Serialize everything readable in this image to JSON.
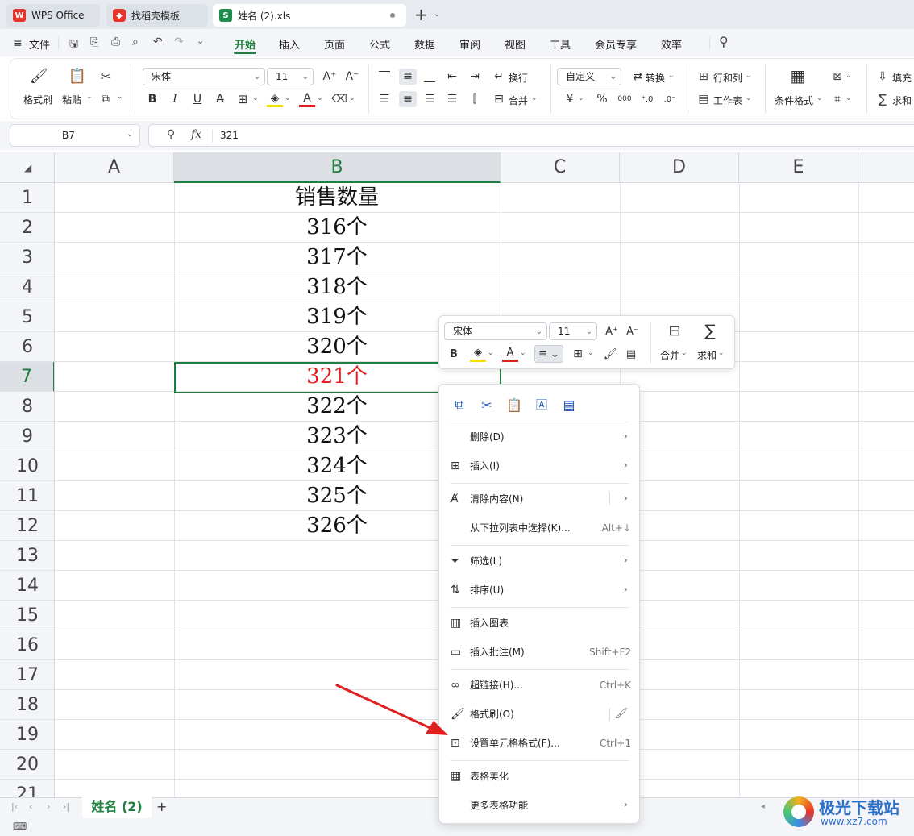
{
  "tabs": [
    {
      "label": "WPS Office",
      "icon": "wps-logo-icon",
      "color": "#e8332a"
    },
    {
      "label": "找稻壳模板",
      "icon": "docer-icon",
      "color": "#e8332a"
    },
    {
      "label": "姓名 (2).xls",
      "icon": "spreadsheet-s-icon",
      "color": "#1e8e4e"
    }
  ],
  "menu": {
    "file": "文件",
    "items": [
      "开始",
      "插入",
      "页面",
      "公式",
      "数据",
      "审阅",
      "视图",
      "工具",
      "会员专享",
      "效率"
    ],
    "active": "开始"
  },
  "ribbon": {
    "format_painter": "格式刷",
    "paste": "粘贴",
    "font_name": "宋体",
    "font_size": "11",
    "wrap": "换行",
    "merge": "合并",
    "number_format": "自定义",
    "convert": "转换",
    "rows_cols": "行和列",
    "worksheet": "工作表",
    "cond_format": "条件格式",
    "fill": "填充",
    "sum": "求和",
    "bold": "B",
    "italic": "I",
    "underline": "U",
    "currency": "¥",
    "percent": "%",
    "thousands": "000"
  },
  "formula_bar": {
    "cell_ref": "B7",
    "fx": "fx",
    "value": "321"
  },
  "grid": {
    "columns": [
      "A",
      "B",
      "C",
      "D",
      "E"
    ],
    "selected_column": "B",
    "rows": [
      "1",
      "2",
      "3",
      "4",
      "5",
      "6",
      "7",
      "8",
      "9",
      "10",
      "11",
      "12",
      "13",
      "14",
      "15",
      "16",
      "17",
      "18",
      "19",
      "20",
      "21"
    ],
    "selected_row": "7",
    "b_values": [
      "销售数量",
      "316个",
      "317个",
      "318个",
      "319个",
      "320个",
      "321个",
      "322个",
      "323个",
      "324个",
      "325个",
      "326个"
    ],
    "highlight_color": "#e02020"
  },
  "mini_toolbar": {
    "font_name": "宋体",
    "font_size": "11",
    "bold": "B",
    "merge": "合并",
    "sum": "求和"
  },
  "context_menu": {
    "items": [
      {
        "label": "删除(D)",
        "shortcut": "",
        "submenu": true
      },
      {
        "label": "插入(I)",
        "shortcut": "",
        "submenu": true
      },
      {
        "label": "清除内容(N)",
        "shortcut": "",
        "submenu": true
      },
      {
        "label": "从下拉列表中选择(K)...",
        "shortcut": "Alt+↓",
        "submenu": false
      },
      {
        "label": "筛选(L)",
        "shortcut": "",
        "submenu": true
      },
      {
        "label": "排序(U)",
        "shortcut": "",
        "submenu": true
      },
      {
        "label": "插入图表",
        "shortcut": "",
        "submenu": false
      },
      {
        "label": "插入批注(M)",
        "shortcut": "Shift+F2",
        "submenu": false
      },
      {
        "label": "超链接(H)...",
        "shortcut": "Ctrl+K",
        "submenu": false
      },
      {
        "label": "格式刷(O)",
        "shortcut": "",
        "submenu": false
      },
      {
        "label": "设置单元格格式(F)...",
        "shortcut": "Ctrl+1",
        "submenu": false
      },
      {
        "label": "表格美化",
        "shortcut": "",
        "submenu": false
      },
      {
        "label": "更多表格功能",
        "shortcut": "",
        "submenu": true
      }
    ]
  },
  "sheet_tab": "姓名 (2)",
  "watermark": {
    "name": "极光下载站",
    "url": "www.xz7.com"
  },
  "annotation_color": "#e02020"
}
